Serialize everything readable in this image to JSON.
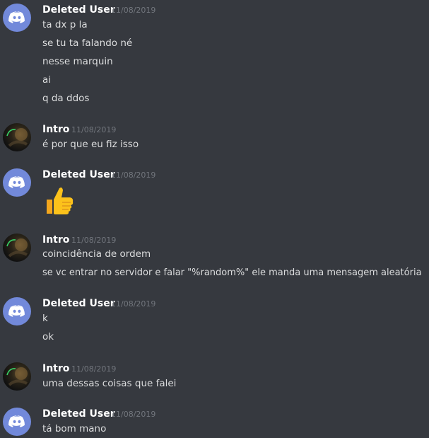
{
  "messages": [
    {
      "author": "Deleted User",
      "timestamp": "11/08/2019",
      "avatar": "discord-logo-avatar",
      "lines": [
        "ta dx p la",
        "se tu ta falando né",
        "nesse marquin",
        "ai",
        "q da ddos"
      ]
    },
    {
      "author": "Intro",
      "timestamp": "11/08/2019",
      "avatar": "photo-avatar",
      "lines": [
        "é por que eu fiz isso"
      ]
    },
    {
      "author": "Deleted User",
      "timestamp": "11/08/2019",
      "avatar": "discord-logo-avatar",
      "emoji": "thumbs-up-emoji",
      "lines": []
    },
    {
      "author": "Intro",
      "timestamp": "11/08/2019",
      "avatar": "photo-avatar",
      "lines": [
        "coincidência de ordem",
        "se vc entrar no servidor e falar \"%random%\" ele manda uma mensagem aleatória"
      ]
    },
    {
      "author": "Deleted User",
      "timestamp": "11/08/2019",
      "avatar": "discord-logo-avatar",
      "lines": [
        "k",
        "ok"
      ]
    },
    {
      "author": "Intro",
      "timestamp": "11/08/2019",
      "avatar": "photo-avatar",
      "lines": [
        "uma dessas coisas que falei"
      ]
    },
    {
      "author": "Deleted User",
      "timestamp": "11/08/2019",
      "avatar": "discord-logo-avatar",
      "lines": [
        "tá bom mano"
      ]
    }
  ],
  "colors": {
    "background": "#36393f",
    "username": "#ffffff",
    "timestamp": "#72767d",
    "text": "#dcddde",
    "discord_blurple": "#7289da"
  }
}
